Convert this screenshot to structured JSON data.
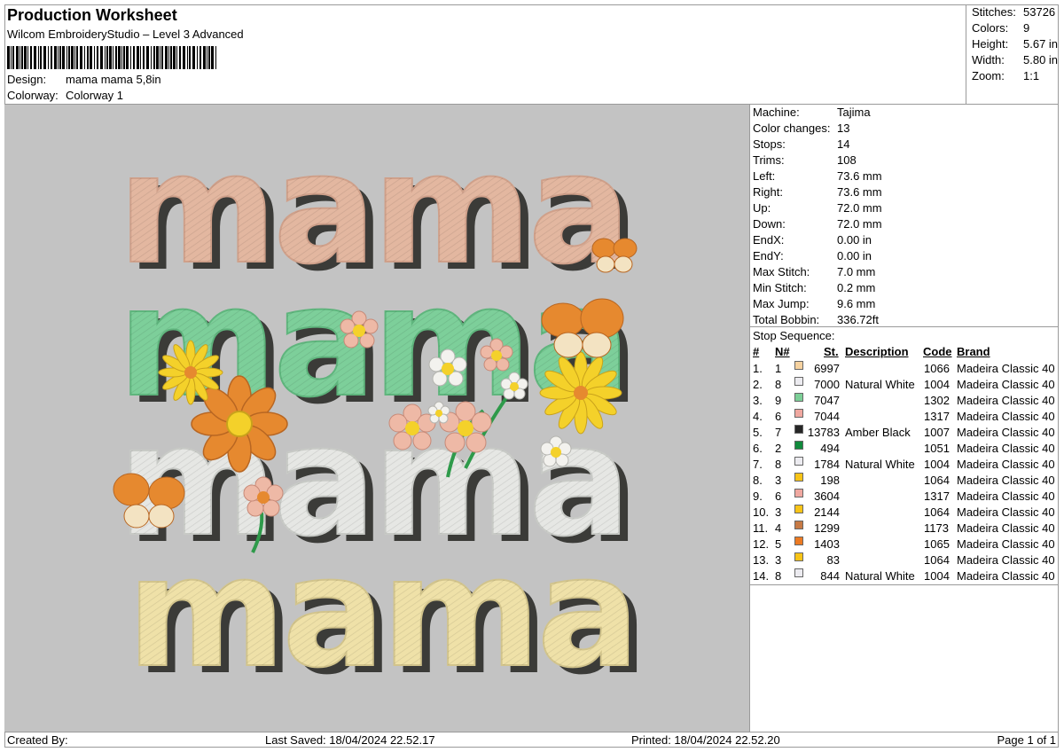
{
  "header": {
    "title": "Production Worksheet",
    "software": "Wilcom EmbroideryStudio – Level 3 Advanced",
    "design_label": "Design:",
    "design_value": "mama mama 5,8in",
    "colorway_label": "Colorway:",
    "colorway_value": "Colorway 1"
  },
  "stats": [
    {
      "label": "Stitches:",
      "value": "53726"
    },
    {
      "label": "Colors:",
      "value": "9"
    },
    {
      "label": "Height:",
      "value": "5.67 in"
    },
    {
      "label": "Width:",
      "value": "5.80 in"
    },
    {
      "label": "Zoom:",
      "value": "1:1"
    }
  ],
  "machine_info": [
    {
      "label": "Machine:",
      "value": "Tajima"
    },
    {
      "label": "Color changes:",
      "value": "13"
    },
    {
      "label": "Stops:",
      "value": "14"
    },
    {
      "label": "Trims:",
      "value": "108"
    },
    {
      "label": "Left:",
      "value": "73.6 mm"
    },
    {
      "label": "Right:",
      "value": "73.6 mm"
    },
    {
      "label": "Up:",
      "value": "72.0 mm"
    },
    {
      "label": "Down:",
      "value": "72.0 mm"
    },
    {
      "label": "EndX:",
      "value": "0.00 in"
    },
    {
      "label": "EndY:",
      "value": "0.00 in"
    },
    {
      "label": "Max Stitch:",
      "value": "7.0 mm"
    },
    {
      "label": "Min Stitch:",
      "value": "0.2 mm"
    },
    {
      "label": "Max Jump:",
      "value": "9.6 mm"
    },
    {
      "label": "Total Bobbin:",
      "value": "336.72ft"
    }
  ],
  "stop_sequence": {
    "title": "Stop Sequence:",
    "headers": {
      "num": "#",
      "n": "N#",
      "st": "St.",
      "desc": "Description",
      "code": "Code",
      "brand": "Brand"
    },
    "rows": [
      {
        "num": "1.",
        "n": "1",
        "color": "#f6d2a0",
        "st": "6997",
        "desc": "",
        "code": "1066",
        "brand": "Madeira Classic 40"
      },
      {
        "num": "2.",
        "n": "8",
        "color": "#ecebf0",
        "st": "7000",
        "desc": "Natural White",
        "code": "1004",
        "brand": "Madeira Classic 40"
      },
      {
        "num": "3.",
        "n": "9",
        "color": "#7ccf97",
        "st": "7047",
        "desc": "",
        "code": "1302",
        "brand": "Madeira Classic 40"
      },
      {
        "num": "4.",
        "n": "6",
        "color": "#f0a8a0",
        "st": "7044",
        "desc": "",
        "code": "1317",
        "brand": "Madeira Classic 40"
      },
      {
        "num": "5.",
        "n": "7",
        "color": "#262626",
        "st": "13783",
        "desc": "Amber Black",
        "code": "1007",
        "brand": "Madeira Classic 40"
      },
      {
        "num": "6.",
        "n": "2",
        "color": "#118a3c",
        "st": "494",
        "desc": "",
        "code": "1051",
        "brand": "Madeira Classic 40"
      },
      {
        "num": "7.",
        "n": "8",
        "color": "#ecebf0",
        "st": "1784",
        "desc": "Natural White",
        "code": "1004",
        "brand": "Madeira Classic 40"
      },
      {
        "num": "8.",
        "n": "3",
        "color": "#f8c417",
        "st": "198",
        "desc": "",
        "code": "1064",
        "brand": "Madeira Classic 40"
      },
      {
        "num": "9.",
        "n": "6",
        "color": "#f0a8a0",
        "st": "3604",
        "desc": "",
        "code": "1317",
        "brand": "Madeira Classic 40"
      },
      {
        "num": "10.",
        "n": "3",
        "color": "#f8c417",
        "st": "2144",
        "desc": "",
        "code": "1064",
        "brand": "Madeira Classic 40"
      },
      {
        "num": "11.",
        "n": "4",
        "color": "#c77a45",
        "st": "1299",
        "desc": "",
        "code": "1173",
        "brand": "Madeira Classic 40"
      },
      {
        "num": "12.",
        "n": "5",
        "color": "#ec7a22",
        "st": "1403",
        "desc": "",
        "code": "1065",
        "brand": "Madeira Classic 40"
      },
      {
        "num": "13.",
        "n": "3",
        "color": "#f8c417",
        "st": "83",
        "desc": "",
        "code": "1064",
        "brand": "Madeira Classic 40"
      },
      {
        "num": "14.",
        "n": "8",
        "color": "#ecebf0",
        "st": "844",
        "desc": "Natural White",
        "code": "1004",
        "brand": "Madeira Classic 40"
      }
    ]
  },
  "footer": {
    "created_by": "Created By:",
    "last_saved": "Last Saved: 18/04/2024 22.52.17",
    "printed": "Printed: 18/04/2024 22.52.20",
    "page": "Page 1 of 1"
  },
  "design_preview": {
    "words": [
      "mama",
      "mama",
      "mama",
      "mama"
    ],
    "colors": {
      "background": "#c3c3c3",
      "row1": "#e3b7a0",
      "row2": "#7dcf9a",
      "row3": "#e6e7e4",
      "row4": "#efe1a8",
      "shadow": "#3b3b38",
      "flower_orange": "#e6892f",
      "flower_yellow": "#f4d12a",
      "flower_pink": "#eeb9a6",
      "flower_white": "#f3f2ee",
      "stem": "#2e9a4a"
    }
  }
}
